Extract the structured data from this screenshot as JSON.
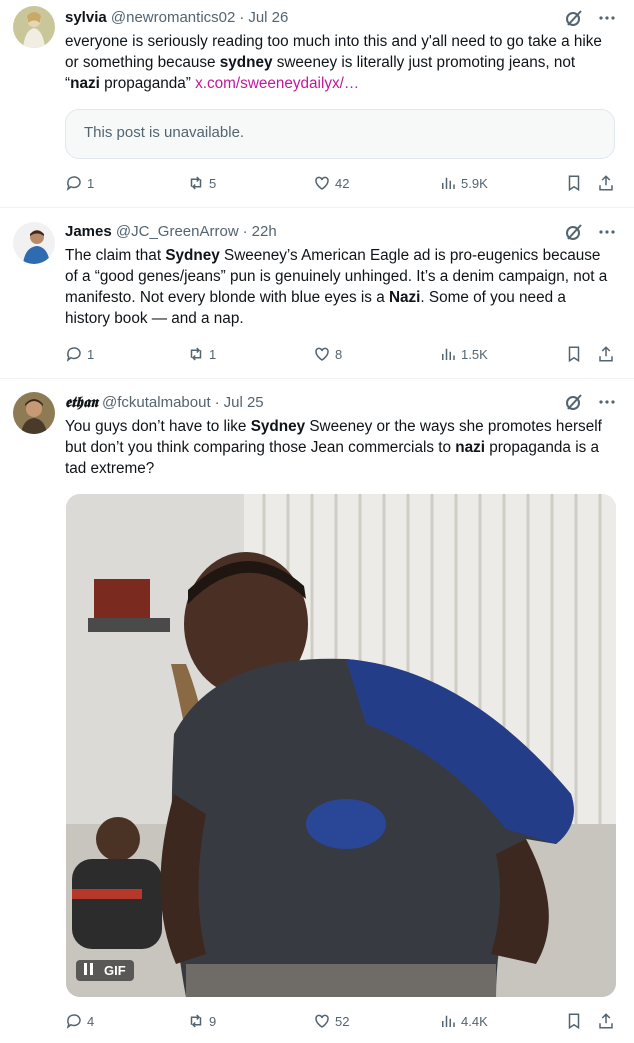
{
  "tweets": [
    {
      "name": "sylvia",
      "handle": "@newromantics02",
      "time": "Jul 26",
      "text_parts": [
        {
          "t": "everyone is seriously reading too much into this and y'all need to go take a hike or something because "
        },
        {
          "b": "sydney"
        },
        {
          "t": " sweeney is literally just promoting jeans, not “"
        },
        {
          "b": "nazi"
        },
        {
          "t": " propaganda” "
        }
      ],
      "link": "x.com/sweeneydailyx/…",
      "quote_unavailable": "This post is unavailable.",
      "replies": "1",
      "reposts": "5",
      "likes": "42",
      "views": "5.9K"
    },
    {
      "name": "James",
      "handle": "@JC_GreenArrow",
      "time": "22h",
      "text_parts": [
        {
          "t": "The claim that "
        },
        {
          "b": "Sydney"
        },
        {
          "t": " Sweeney’s American Eagle ad is pro-eugenics because of a “good genes/jeans” pun is genuinely unhinged. It’s a denim campaign, not a manifesto. Not every blonde with blue eyes is a "
        },
        {
          "b": "Nazi"
        },
        {
          "t": ". Some of you need a history book — and a nap."
        }
      ],
      "replies": "1",
      "reposts": "1",
      "likes": "8",
      "views": "1.5K"
    },
    {
      "name": "𝖊𝖙𝖍𝖆𝖓",
      "handle": "@fckutalmabout",
      "time": "Jul 25",
      "text_parts": [
        {
          "t": "You guys don’t have to like "
        },
        {
          "b": "Sydney"
        },
        {
          "t": " Sweeney or the ways she promotes herself but don’t you think comparing those Jean commercials to "
        },
        {
          "b": "nazi"
        },
        {
          "t": " propaganda is a tad extreme?"
        }
      ],
      "gif_label": "GIF",
      "replies": "4",
      "reposts": "9",
      "likes": "52",
      "views": "4.4K"
    }
  ]
}
